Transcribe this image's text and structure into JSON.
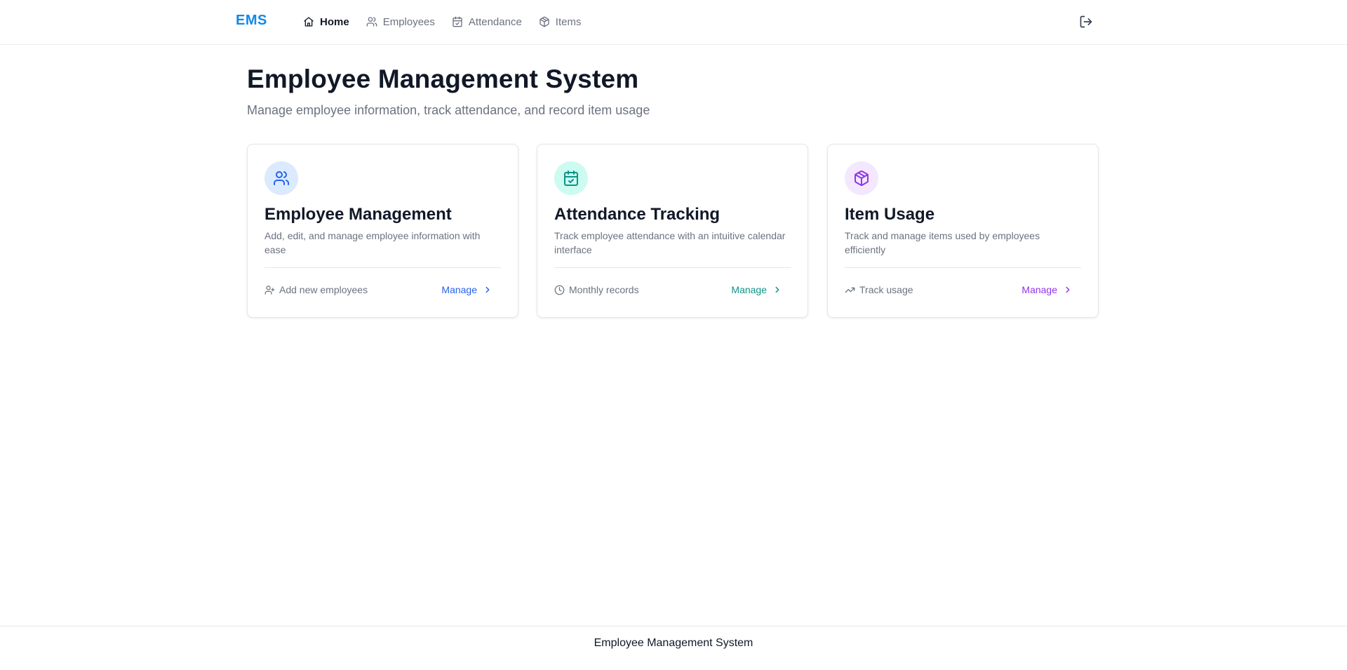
{
  "brand": "EMS",
  "nav": {
    "items": [
      {
        "label": "Home",
        "icon": "home-icon",
        "active": true
      },
      {
        "label": "Employees",
        "icon": "users-icon",
        "active": false
      },
      {
        "label": "Attendance",
        "icon": "calendar-icon",
        "active": false
      },
      {
        "label": "Items",
        "icon": "box-icon",
        "active": false
      }
    ],
    "logout_icon": "logout-icon"
  },
  "header": {
    "title": "Employee Management System",
    "subtitle": "Manage employee information, track attendance, and record item usage"
  },
  "cards": [
    {
      "title": "Employee Management",
      "description": "Add, edit, and manage employee information with ease",
      "footer_text": "Add new employees",
      "footer_icon": "user-plus-icon",
      "action": "Manage",
      "icon": "users-icon",
      "accent": "#2563eb"
    },
    {
      "title": "Attendance Tracking",
      "description": "Track employee attendance with an intuitive calendar interface",
      "footer_text": "Monthly records",
      "footer_icon": "clock-icon",
      "action": "Manage",
      "icon": "calendar-check-icon",
      "accent": "#0d9488"
    },
    {
      "title": "Item Usage",
      "description": "Track and manage items used by employees efficiently",
      "footer_text": "Track usage",
      "footer_icon": "trending-up-icon",
      "action": "Manage",
      "icon": "box-icon",
      "accent": "#9333ea"
    }
  ],
  "footer": {
    "text": "Employee Management System"
  },
  "colors": {
    "brand": "#1089e6",
    "blue": "#2563eb",
    "teal": "#0d9488",
    "purple": "#9333ea"
  }
}
